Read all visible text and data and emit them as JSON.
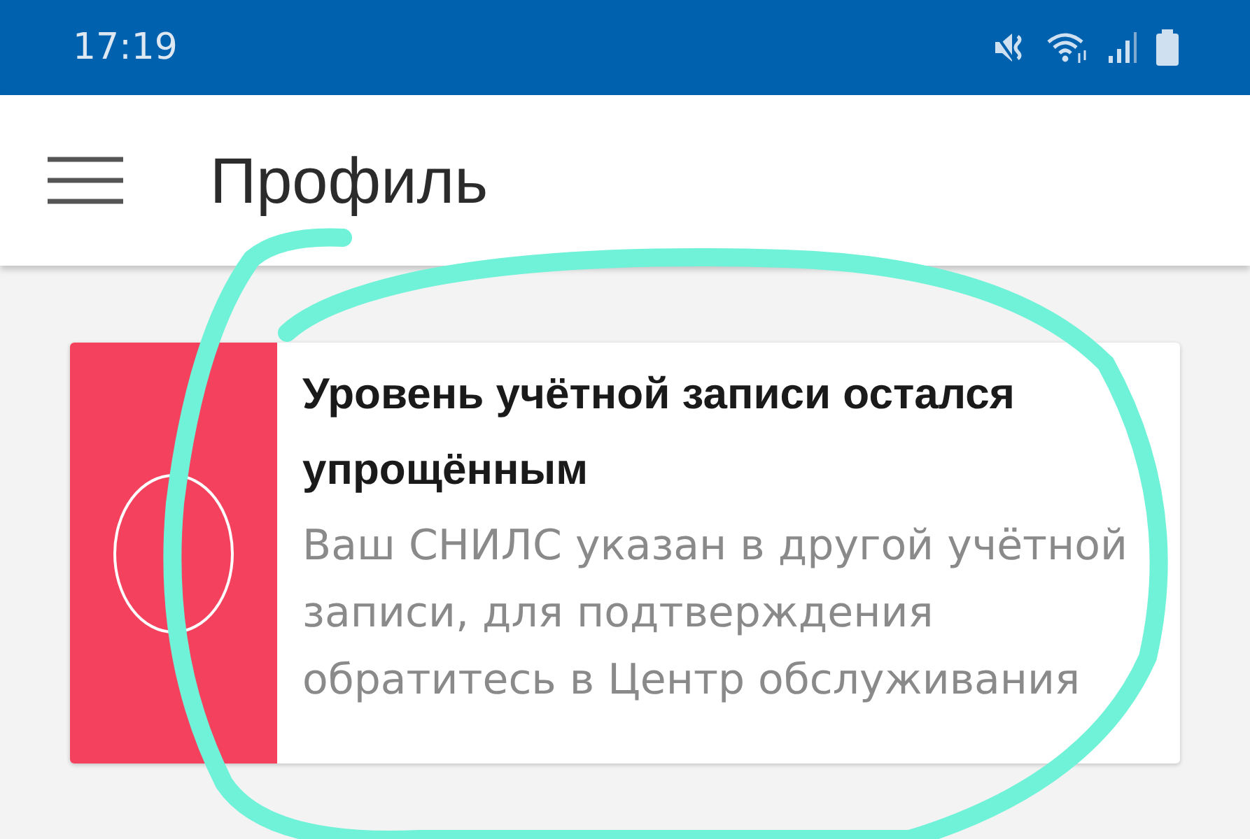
{
  "status_bar": {
    "time": "17:19"
  },
  "app_bar": {
    "title": "Профиль"
  },
  "alert_card": {
    "title": "Уровень учётной записи остался упрощённым",
    "message": "Ваш СНИЛС указан в другой учётной записи, для подтверждения обратитесь в Центр обслуживания"
  }
}
